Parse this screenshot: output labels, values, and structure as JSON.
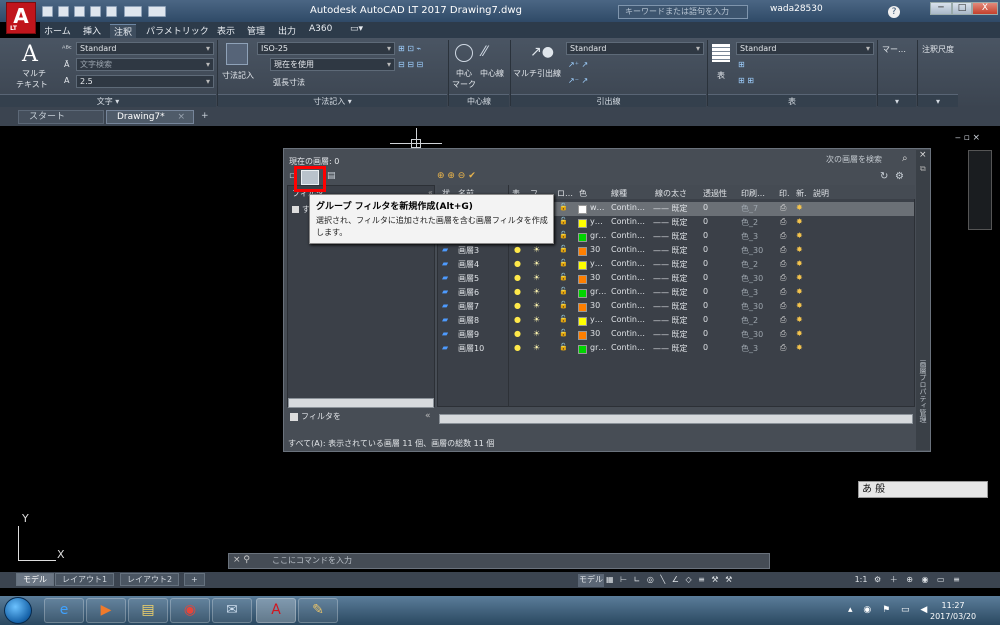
{
  "window": {
    "title": "Autodesk AutoCAD LT 2017     Drawing7.dwg",
    "search_placeholder": "キーワードまたは語句を入力",
    "user": "wada28530",
    "logo_text": "A",
    "logo_sub": "LT",
    "min": "─",
    "max": "□",
    "close": "X"
  },
  "menu": {
    "tabs": [
      {
        "label": "ホーム"
      },
      {
        "label": "挿入"
      },
      {
        "label": "注釈"
      },
      {
        "label": "パラメトリック"
      },
      {
        "label": "表示"
      },
      {
        "label": "管理"
      },
      {
        "label": "出力"
      },
      {
        "label": "A360"
      }
    ]
  },
  "ribbon": {
    "text_panel": {
      "big_label_1": "マルチ",
      "big_label_2": "テキスト",
      "style": "Standard",
      "find_placeholder": "文字検索",
      "height": "2.5",
      "label": "文字 ▾"
    },
    "dim_panel": {
      "big_label": "寸法記入",
      "style": "ISO-25",
      "layer": "現在を使用",
      "arc": "弧長寸法",
      "label": "寸法記入 ▾"
    },
    "center_panel": {
      "mark_1": "中心",
      "mark_2": "マーク",
      "line": "中心線",
      "label": "中心線"
    },
    "leader_panel": {
      "big_label": "マルチ引出線",
      "style": "Standard",
      "label": "引出線"
    },
    "table_panel": {
      "big_label": "表",
      "style": "Standard",
      "label": "表"
    },
    "markup": {
      "label": "マー…"
    },
    "annot_scale": {
      "label": "注釈尺度"
    }
  },
  "file_tabs": {
    "start": "スタート",
    "drawing": "Drawing7*",
    "add": "+"
  },
  "layer_palette": {
    "current_layer": "現在の画層: 0",
    "search_placeholder": "次の画層を検索",
    "filter_header": "フィルタ",
    "filter_root": "すべて",
    "filter_invert": "フィルタを",
    "status": "すべて(A): 表示されている画層 11 個、画層の総数 11 個",
    "side_label": "画層プロパティ管理",
    "columns": [
      "状",
      "名前",
      "表",
      "フ",
      "ロ…",
      "色",
      "線種",
      "線の太さ",
      "透過性",
      "印刷…",
      "印.",
      "新.",
      "説明"
    ],
    "rows": [
      {
        "name": "0",
        "color_name": "w…",
        "color": "#ffffff",
        "linetype": "Contin…",
        "lineweight": "—— 既定",
        "transparency": "0",
        "plot_style": "色_7"
      },
      {
        "name": "画層1",
        "color_name": "y…",
        "color": "#ffff00",
        "linetype": "Contin…",
        "lineweight": "—— 既定",
        "transparency": "0",
        "plot_style": "色_2"
      },
      {
        "name": "画層2",
        "color_name": "gr…",
        "color": "#00d400",
        "linetype": "Contin…",
        "lineweight": "—— 既定",
        "transparency": "0",
        "plot_style": "色_3"
      },
      {
        "name": "画層3",
        "color_name": "30",
        "color": "#ff7f00",
        "linetype": "Contin…",
        "lineweight": "—— 既定",
        "transparency": "0",
        "plot_style": "色_30"
      },
      {
        "name": "画層4",
        "color_name": "y…",
        "color": "#ffff00",
        "linetype": "Contin…",
        "lineweight": "—— 既定",
        "transparency": "0",
        "plot_style": "色_2"
      },
      {
        "name": "画層5",
        "color_name": "30",
        "color": "#ff7f00",
        "linetype": "Contin…",
        "lineweight": "—— 既定",
        "transparency": "0",
        "plot_style": "色_30"
      },
      {
        "name": "画層6",
        "color_name": "gr…",
        "color": "#00d400",
        "linetype": "Contin…",
        "lineweight": "—— 既定",
        "transparency": "0",
        "plot_style": "色_3"
      },
      {
        "name": "画層7",
        "color_name": "30",
        "color": "#ff7f00",
        "linetype": "Contin…",
        "lineweight": "—— 既定",
        "transparency": "0",
        "plot_style": "色_30"
      },
      {
        "name": "画層8",
        "color_name": "y…",
        "color": "#ffff00",
        "linetype": "Contin…",
        "lineweight": "—— 既定",
        "transparency": "0",
        "plot_style": "色_2"
      },
      {
        "name": "画層9",
        "color_name": "30",
        "color": "#ff7f00",
        "linetype": "Contin…",
        "lineweight": "—— 既定",
        "transparency": "0",
        "plot_style": "色_30"
      },
      {
        "name": "画層10",
        "color_name": "gr…",
        "color": "#00d400",
        "linetype": "Contin…",
        "lineweight": "—— 既定",
        "transparency": "0",
        "plot_style": "色_3"
      }
    ],
    "tooltip": {
      "title": "グループ フィルタを新規作成(Alt+G)",
      "description": "選択され、フィルタに追加された画層を含む画層フィルタを作成します。"
    }
  },
  "command_line": {
    "placeholder": "ここにコマンドを入力"
  },
  "layout_tabs": {
    "model": "モデル",
    "layout1": "レイアウト1",
    "layout2": "レイアウト2",
    "add": "+"
  },
  "status_bar": {
    "model": "モデル",
    "scale": "1:1"
  },
  "ime": {
    "text": "あ 般"
  },
  "ucs": {
    "y": "Y",
    "x": "X"
  },
  "taskbar": {
    "time": "11:27",
    "date": "2017/03/20"
  }
}
